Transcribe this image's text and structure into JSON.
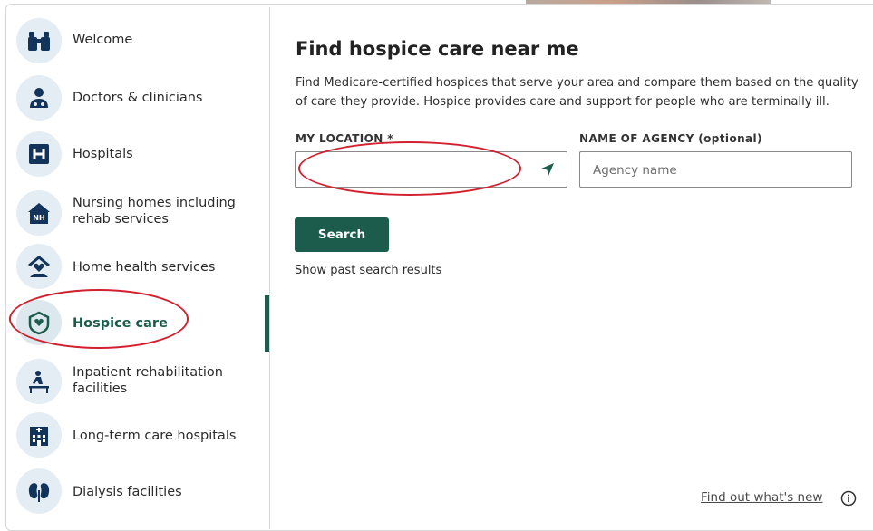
{
  "sidebar": {
    "items": [
      {
        "label": "Welcome",
        "icon": "binoculars-icon"
      },
      {
        "label": "Doctors & clinicians",
        "icon": "doctor-icon"
      },
      {
        "label": "Hospitals",
        "icon": "hospital-h-icon"
      },
      {
        "label": "Nursing homes including\nrehab services",
        "icon": "nursing-home-icon",
        "icon_text": "NH"
      },
      {
        "label": "Home health services",
        "icon": "home-health-icon"
      },
      {
        "label": "Hospice care",
        "icon": "hospice-heart-hands-icon",
        "active": true
      },
      {
        "label": "Inpatient rehabilitation\nfacilities",
        "icon": "rehab-icon"
      },
      {
        "label": "Long-term care hospitals",
        "icon": "hospital-building-icon"
      },
      {
        "label": "Dialysis facilities",
        "icon": "kidney-icon"
      }
    ]
  },
  "main": {
    "title": "Find hospice care near me",
    "description": "Find Medicare-certified hospices that serve your area and compare them based on the quality of care they provide. Hospice provides care and support for people who are terminally ill.",
    "location_label": "MY LOCATION *",
    "location_value": "",
    "location_placeholder": "",
    "agency_label": "NAME OF AGENCY (optional)",
    "agency_placeholder": "Agency name",
    "search_label": "Search",
    "past_results_link": "Show past search results",
    "whats_new_link": "Find out what's new"
  },
  "colors": {
    "primary": "#1b5c4c",
    "icon_bg": "#e4ecf4",
    "icon_fg": "#13345a",
    "annotation": "#d2202f"
  }
}
